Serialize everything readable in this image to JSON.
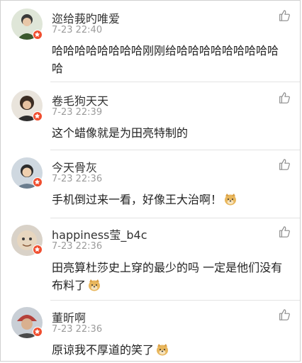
{
  "comments": [
    {
      "name": "迩给莪旳唯爱",
      "time": "7-23 22:40",
      "text": "哈哈哈哈哈哈哈哈刚刚给哈哈哈哈哈哈哈哈哈哈",
      "emoji": ""
    },
    {
      "name": "卷毛狗天天",
      "time": "7-23 22:39",
      "text": "这个蜡像就是为田亮特制的",
      "emoji": ""
    },
    {
      "name": "今天骨灰",
      "time": "7-23 22:36",
      "text": "手机倒过来一看，好像王大治啊！",
      "emoji": "doge-emoji"
    },
    {
      "name": "happiness莹_b4c",
      "time": "7-23 22:36",
      "text": "田亮算杜莎史上穿的最少的吗 一定是他们没有布料了",
      "emoji": "doge-emoji"
    },
    {
      "name": "董昕啊",
      "time": "7-23 22:36",
      "text": "原谅我不厚道的笑了",
      "emoji": "doge-emoji"
    }
  ],
  "icons": {
    "like": "thumbs-up-icon",
    "badge": "vip-badge-icon"
  },
  "colors": {
    "name": "#333333",
    "time": "#9b9b9b",
    "text": "#222222",
    "badge": "#f04e2f",
    "divider": "#e3e3e3"
  }
}
